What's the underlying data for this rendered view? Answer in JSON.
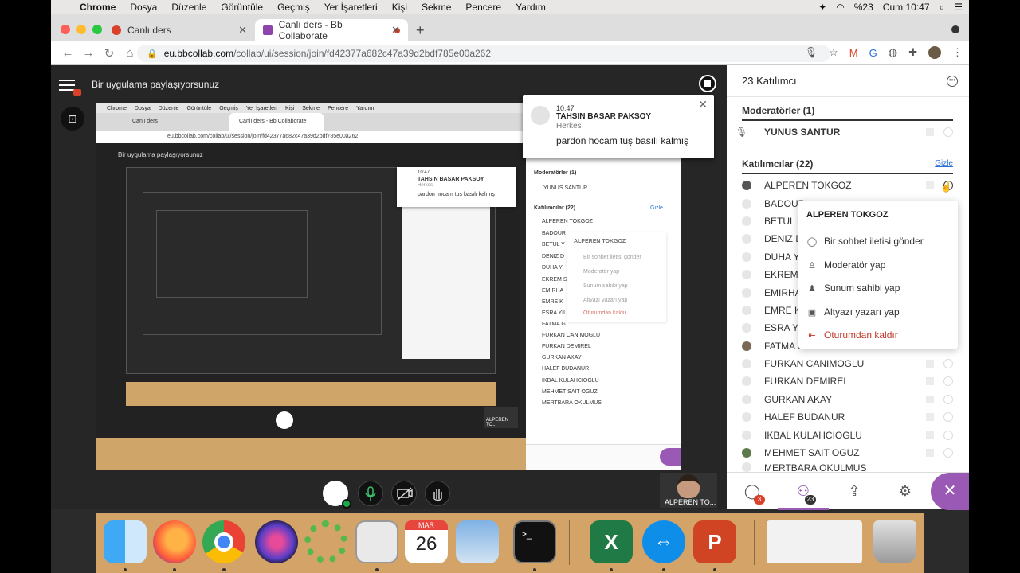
{
  "menubar": {
    "app": "Chrome",
    "items": [
      "Dosya",
      "Düzenle",
      "Görüntüle",
      "Geçmiş",
      "Yer İşaretleri",
      "Kişi",
      "Sekme",
      "Pencere",
      "Yardım"
    ],
    "battery": "%23",
    "clock": "Cum 10:47"
  },
  "tabs": [
    {
      "title": "Canlı ders",
      "favicon_color": "#d9412a"
    },
    {
      "title": "Canlı ders - Bb Collaborate",
      "favicon_color": "#8e44ad"
    }
  ],
  "address": {
    "domain": "eu.bbcollab.com",
    "path": "/collab/ui/session/join/fd42377a682c47a39d2bdf785e00a262"
  },
  "stage": {
    "share_label": "Bir uygulama paylaşıyorsunuz"
  },
  "chat_popup": {
    "time": "10:47",
    "sender": "TAHSIN BASAR PAKSOY",
    "to": "Herkes",
    "message": "pardon hocam tuş basılı kalmış"
  },
  "self_cam": {
    "label": "ALPEREN TO..."
  },
  "panel": {
    "title": "23 Katılımcı",
    "moderators_header": "Moderatörler (1)",
    "moderator": "YUNUS SANTUR",
    "participants_header": "Katılımcılar (22)",
    "hide_label": "Gizle",
    "participants": [
      "ALPEREN TOKGOZ",
      "BADOUR",
      "BETUL Y",
      "DENIZ D",
      "DUHA Y",
      "EKREM S",
      "EMIRHA",
      "EMRE KU",
      "ESRA YIL",
      "FATMA G",
      "FURKAN CANIMOGLU",
      "FURKAN DEMIREL",
      "GURKAN AKAY",
      "HALEF BUDANUR",
      "IKBAL KULAHCIOGLU",
      "MEHMET SAIT OGUZ",
      "MERTBARA OKULMUS"
    ]
  },
  "context_menu": {
    "title": "ALPEREN TOKGOZ",
    "items": [
      {
        "label": "Bir sohbet iletisi gönder",
        "icon": "chat-icon"
      },
      {
        "label": "Moderatör yap",
        "icon": "user-icon"
      },
      {
        "label": "Sunum sahibi yap",
        "icon": "presenter-icon"
      },
      {
        "label": "Altyazı yazarı yap",
        "icon": "caption-icon"
      },
      {
        "label": "Oturumdan kaldır",
        "icon": "exit-icon"
      }
    ]
  },
  "panel_bottom": {
    "chat_badge": "3",
    "participants_badge": "23"
  },
  "mirror": {
    "share_label": "Bir uygulama paylaşıyorsunuz",
    "url": "eu.bbcollab.com/collab/ui/session/join/fd42377a682c47a39d2bdf785e00a262",
    "tab1": "Canlı ders",
    "tab2": "Canlı ders - Bb Collaborate",
    "chat_time": "10:47",
    "chat_sender": "TAHSIN BASAR PAKSOY",
    "chat_to": "Herkes",
    "chat_msg": "pardon hocam tuş basılı kalmış",
    "mod_header": "Moderatörler (1)",
    "moderator": "YUNUS SANTUR",
    "part_header": "Katılımcılar (22)",
    "hide": "Gizle",
    "rows": [
      "ALPEREN TOKGOZ",
      "BADOUR",
      "BETUL Y",
      "DENIZ D",
      "DUHA Y",
      "EKREM S",
      "EMIRHA",
      "EMRE K",
      "ESRA YIL",
      "FATMA G",
      "FURKAN CANIMOGLU",
      "FURKAN DEMIREL",
      "GURKAN AKAY",
      "HALEF BUDANUR",
      "IKBAL KULAHCIOGLU",
      "MEHMET SAIT OGUZ",
      "MERTBARA OKULMUS"
    ],
    "menu_title": "ALPEREN TOKGOZ",
    "menu_items": [
      "Bir sohbet iletisi gönder",
      "Moderatör yap",
      "Sunum sahibi yap",
      "Altyazı yazarı yap",
      "Oturumdan kaldır"
    ],
    "cam_label": "ALPEREN TO..."
  },
  "dock": {
    "calendar_month": "MAR",
    "calendar_day": "26"
  },
  "colors": {
    "accent": "#9b59b6",
    "dock": "#d3a367",
    "danger": "#c0392b"
  }
}
